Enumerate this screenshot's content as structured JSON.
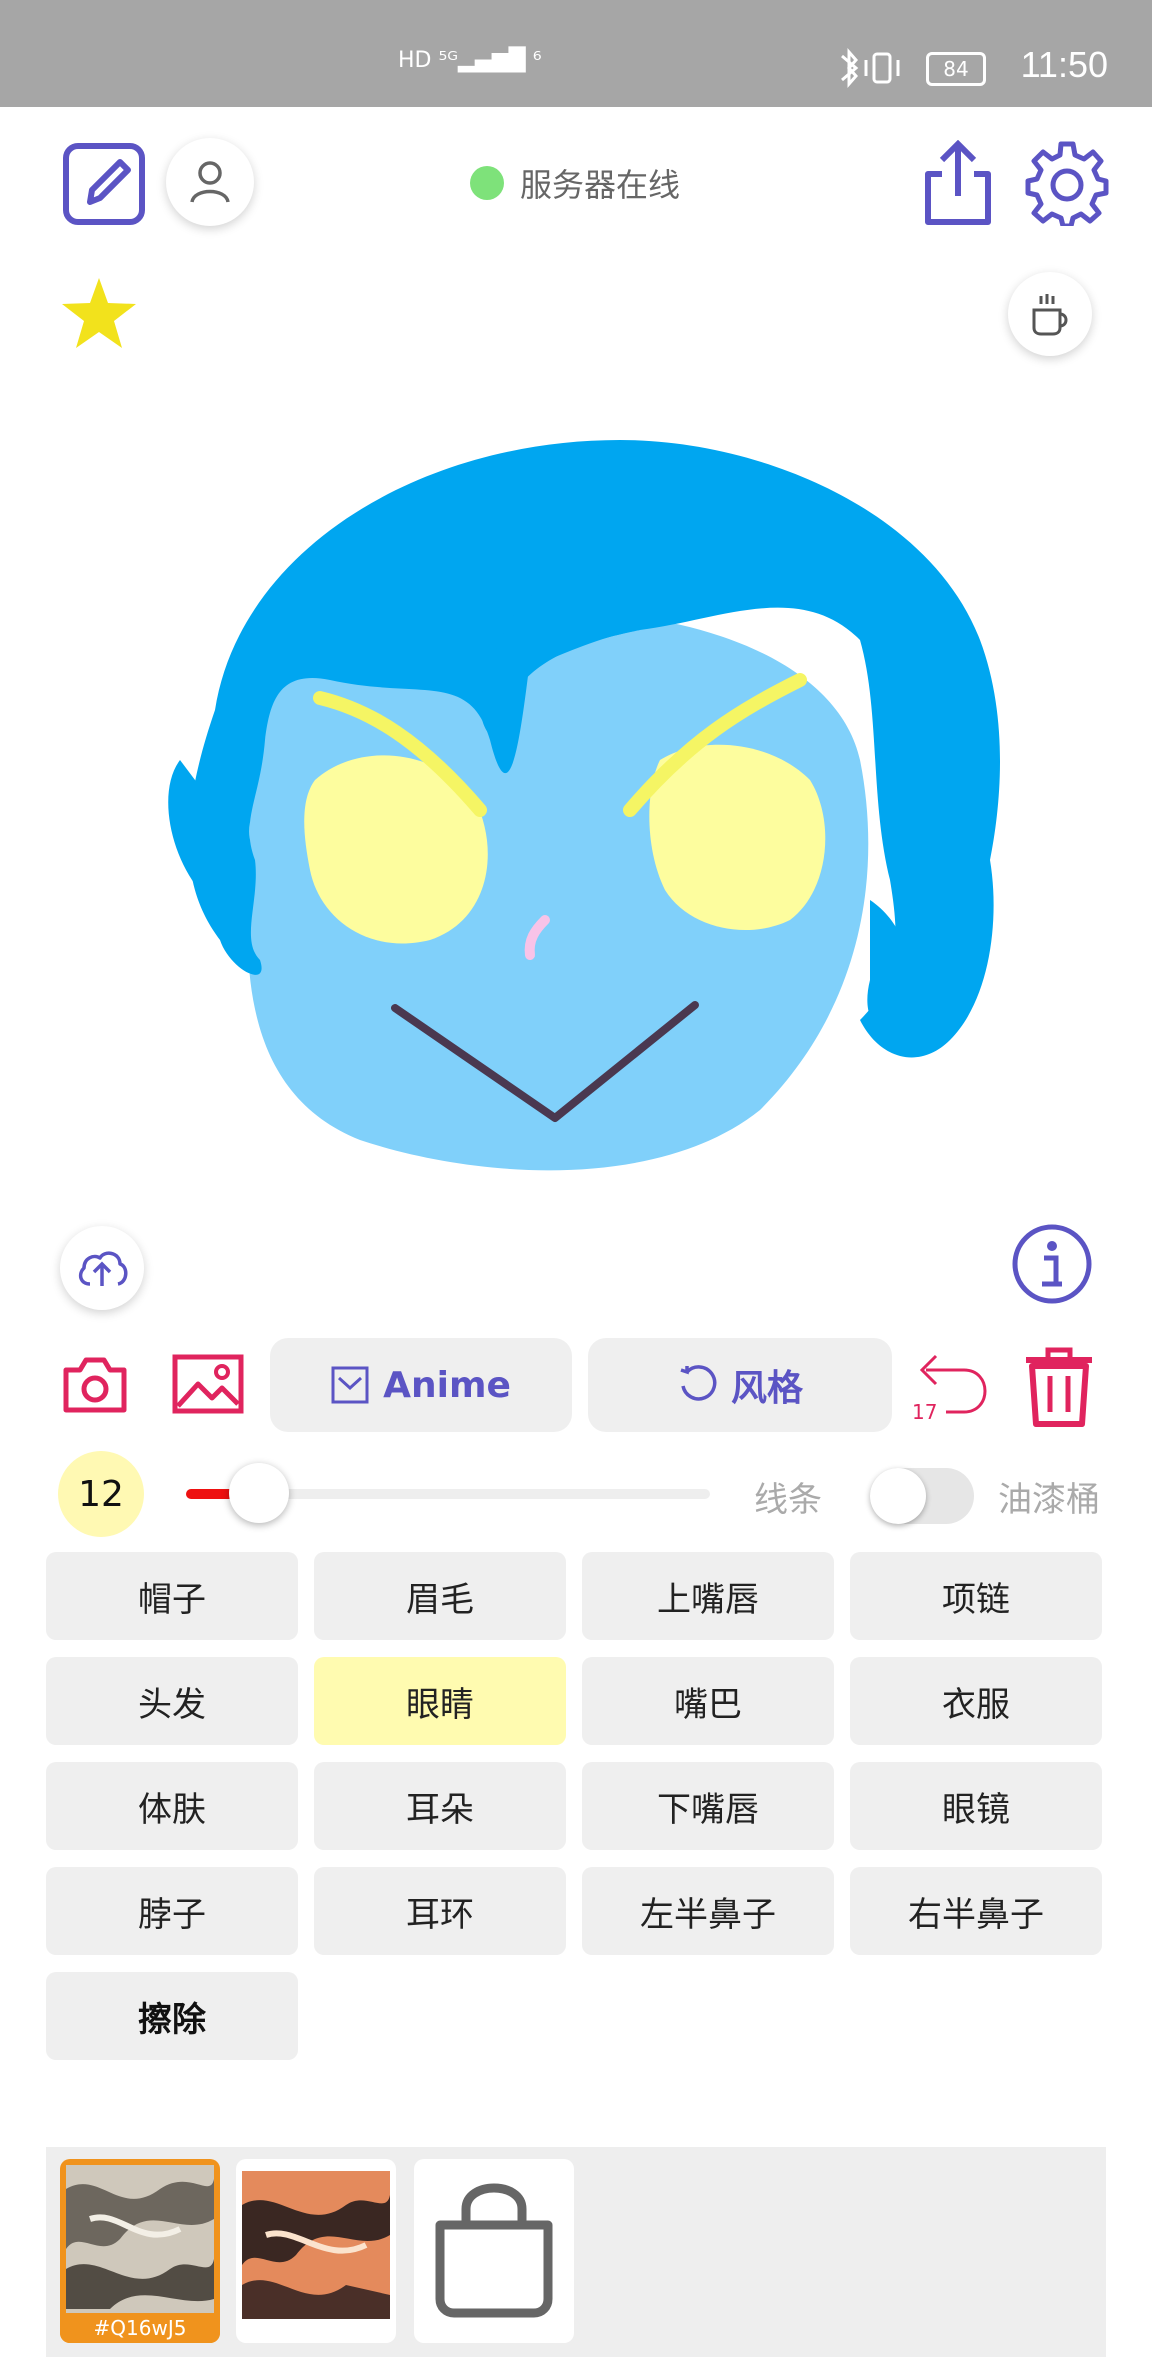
{
  "status_bar": {
    "network": "HD ⁵ᴳ▂▄▆█ ⁶",
    "battery": "84",
    "time": "11:50"
  },
  "header": {
    "server_status": "服务器在线"
  },
  "toolbar": {
    "anime_label": "Anime",
    "style_label": "风格",
    "undo_count": "17"
  },
  "brush": {
    "size": "12",
    "level": 0.14,
    "line_label": "线条",
    "fill_label": "油漆桶",
    "fill_enabled": false,
    "color": "#ee1111"
  },
  "parts": [
    {
      "label": "帽子"
    },
    {
      "label": "眉毛"
    },
    {
      "label": "上嘴唇"
    },
    {
      "label": "项链"
    },
    {
      "label": "头发"
    },
    {
      "label": "眼睛"
    },
    {
      "label": "嘴巴"
    },
    {
      "label": "衣服"
    },
    {
      "label": "体肤"
    },
    {
      "label": "耳朵"
    },
    {
      "label": "下嘴唇"
    },
    {
      "label": "眼镜"
    },
    {
      "label": "脖子"
    },
    {
      "label": "耳环"
    },
    {
      "label": "左半鼻子"
    },
    {
      "label": "右半鼻子"
    },
    {
      "label": "擦除"
    }
  ],
  "selected_part": "眼睛",
  "styles": {
    "first_code": "#Q16wJ5"
  },
  "colors": {
    "accent": "#5b54c4",
    "danger": "#e0245e",
    "star": "#f2e21c",
    "hair": "#00a6f0",
    "skin": "#80d0fa",
    "eyes": "#fdfd9e"
  }
}
